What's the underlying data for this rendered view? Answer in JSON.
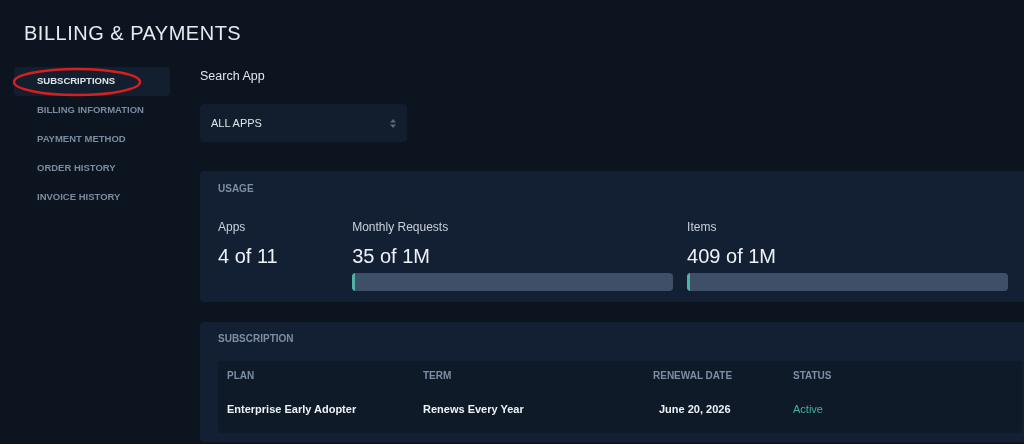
{
  "page_title": "BILLING & PAYMENTS",
  "sidebar": {
    "items": [
      {
        "label": "SUBSCRIPTIONS",
        "selected": true,
        "circled": true
      },
      {
        "label": "BILLING INFORMATION",
        "selected": false,
        "circled": false
      },
      {
        "label": "PAYMENT METHOD",
        "selected": false,
        "circled": false
      },
      {
        "label": "ORDER HISTORY",
        "selected": false,
        "circled": false
      },
      {
        "label": "INVOICE HISTORY",
        "selected": false,
        "circled": false
      }
    ]
  },
  "search": {
    "label": "Search App",
    "select_value": "ALL APPS"
  },
  "usage": {
    "title": "USAGE",
    "metrics": [
      {
        "label": "Apps",
        "value": "4 of 11"
      },
      {
        "label": "Monthly Requests",
        "value": "35 of 1M",
        "level": 0.01
      },
      {
        "label": "Items",
        "value": "409 of 1M",
        "level": 0.01
      }
    ]
  },
  "subscription": {
    "title": "SUBSCRIPTION",
    "columns": [
      "PLAN",
      "TERM",
      "RENEWAL DATE",
      "STATUS"
    ],
    "rows": [
      [
        {
          "text": "Enterprise Early Adopter",
          "kind": "text"
        },
        {
          "text": "Renews Every Year",
          "kind": "text"
        },
        {
          "text": "June 20, 2026",
          "kind": "date"
        },
        {
          "text": "Active",
          "kind": "status"
        }
      ]
    ]
  }
}
